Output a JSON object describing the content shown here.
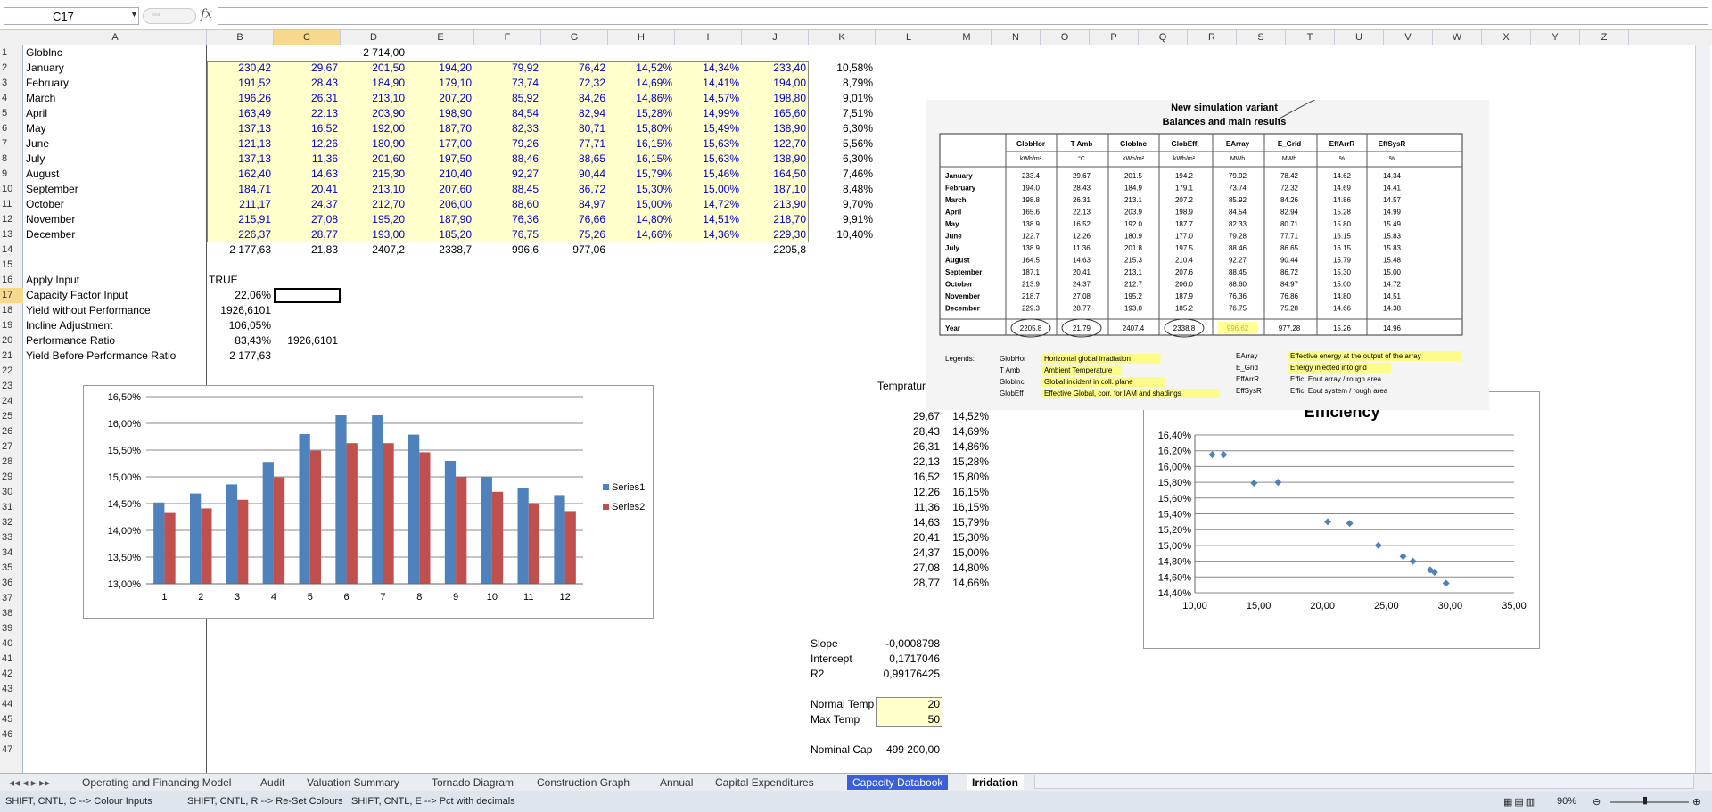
{
  "formula_bar": {
    "name_box": "C17",
    "formula": ""
  },
  "columns": [
    "A",
    "B",
    "C",
    "D",
    "E",
    "F",
    "G",
    "H",
    "I",
    "J",
    "K",
    "L",
    "M",
    "N",
    "O",
    "P",
    "Q",
    "R",
    "S",
    "T",
    "U",
    "V",
    "W",
    "X",
    "Y",
    "Z"
  ],
  "rows": {
    "1": {
      "A": "Globlnc",
      "D": "2 714,00"
    },
    "2": {
      "A": "January",
      "B": "230,42",
      "C": "29,67",
      "D": "201,50",
      "E": "194,20",
      "F": "79,92",
      "G": "76,42",
      "H": "14,52%",
      "I": "14,34%",
      "J": "233,40",
      "K": "10,58%"
    },
    "3": {
      "A": "February",
      "B": "191,52",
      "C": "28,43",
      "D": "184,90",
      "E": "179,10",
      "F": "73,74",
      "G": "72,32",
      "H": "14,69%",
      "I": "14,41%",
      "J": "194,00",
      "K": "8,79%"
    },
    "4": {
      "A": "March",
      "B": "196,26",
      "C": "26,31",
      "D": "213,10",
      "E": "207,20",
      "F": "85,92",
      "G": "84,26",
      "H": "14,86%",
      "I": "14,57%",
      "J": "198,80",
      "K": "9,01%"
    },
    "5": {
      "A": "April",
      "B": "163,49",
      "C": "22,13",
      "D": "203,90",
      "E": "198,90",
      "F": "84,54",
      "G": "82,94",
      "H": "15,28%",
      "I": "14,99%",
      "J": "165,60",
      "K": "7,51%"
    },
    "6": {
      "A": "May",
      "B": "137,13",
      "C": "16,52",
      "D": "192,00",
      "E": "187,70",
      "F": "82,33",
      "G": "80,71",
      "H": "15,80%",
      "I": "15,49%",
      "J": "138,90",
      "K": "6,30%"
    },
    "7": {
      "A": "June",
      "B": "121,13",
      "C": "12,26",
      "D": "180,90",
      "E": "177,00",
      "F": "79,26",
      "G": "77,71",
      "H": "16,15%",
      "I": "15,63%",
      "J": "122,70",
      "K": "5,56%"
    },
    "8": {
      "A": "July",
      "B": "137,13",
      "C": "11,36",
      "D": "201,60",
      "E": "197,50",
      "F": "88,46",
      "G": "88,65",
      "H": "16,15%",
      "I": "15,63%",
      "J": "138,90",
      "K": "6,30%"
    },
    "9": {
      "A": "August",
      "B": "162,40",
      "C": "14,63",
      "D": "215,30",
      "E": "210,40",
      "F": "92,27",
      "G": "90,44",
      "H": "15,79%",
      "I": "15,46%",
      "J": "164,50",
      "K": "7,46%"
    },
    "10": {
      "A": "September",
      "B": "184,71",
      "C": "20,41",
      "D": "213,10",
      "E": "207,60",
      "F": "88,45",
      "G": "86,72",
      "H": "15,30%",
      "I": "15,00%",
      "J": "187,10",
      "K": "8,48%"
    },
    "11": {
      "A": "October",
      "B": "211,17",
      "C": "24,37",
      "D": "212,70",
      "E": "206,00",
      "F": "88,60",
      "G": "84,97",
      "H": "15,00%",
      "I": "14,72%",
      "J": "213,90",
      "K": "9,70%"
    },
    "12": {
      "A": "November",
      "B": "215,91",
      "C": "27,08",
      "D": "195,20",
      "E": "187,90",
      "F": "76,36",
      "G": "76,66",
      "H": "14,80%",
      "I": "14,51%",
      "J": "218,70",
      "K": "9,91%"
    },
    "13": {
      "A": "December",
      "B": "226,37",
      "C": "28,77",
      "D": "193,00",
      "E": "185,20",
      "F": "76,75",
      "G": "75,26",
      "H": "14,66%",
      "I": "14,36%",
      "J": "229,30",
      "K": "10,40%"
    },
    "14": {
      "B": "2 177,63",
      "C": "21,83",
      "D": "2407,2",
      "E": "2338,7",
      "F": "996,6",
      "G": "977,06",
      "J": "2205,8"
    },
    "16": {
      "A": "Apply Input",
      "B": "TRUE"
    },
    "17": {
      "A": "Capacity Factor Input",
      "B": "22,06%"
    },
    "18": {
      "A": "Yield without Performance",
      "B": "1926,6101"
    },
    "19": {
      "A": "Incline Adjustment",
      "B": "106,05%"
    },
    "20": {
      "A": "Performance Ratio",
      "B": "83,43%",
      "C": "1926,6101"
    },
    "21": {
      "A": "Yield Before Performance Ratio",
      "B": "2 177,63"
    },
    "23": {
      "L": "Temprature"
    },
    "24": {
      "M": "Efficiency"
    },
    "25": {
      "L": "29,67",
      "M": "14,52%"
    },
    "26": {
      "L": "28,43",
      "M": "14,69%"
    },
    "27": {
      "L": "26,31",
      "M": "14,86%"
    },
    "28": {
      "L": "22,13",
      "M": "15,28%"
    },
    "29": {
      "L": "16,52",
      "M": "15,80%"
    },
    "30": {
      "L": "12,26",
      "M": "16,15%"
    },
    "31": {
      "L": "11,36",
      "M": "16,15%"
    },
    "32": {
      "L": "14,63",
      "M": "15,79%"
    },
    "33": {
      "L": "20,41",
      "M": "15,30%"
    },
    "34": {
      "L": "24,37",
      "M": "15,00%"
    },
    "35": {
      "L": "27,08",
      "M": "14,80%"
    },
    "36": {
      "L": "28,77",
      "M": "14,66%"
    },
    "40": {
      "K": "Slope",
      "L": "-0,0008798"
    },
    "41": {
      "K": "Intercept",
      "L": "0,1717046"
    },
    "42": {
      "K": "R2",
      "L": "0,99176425"
    },
    "44": {
      "K": "Normal Temp",
      "L": "20"
    },
    "45": {
      "K": "Max Temp",
      "L": "50"
    },
    "47": {
      "K": "Nominal Cap",
      "L": "499 200,00"
    }
  },
  "bar_chart": {
    "chart_data": {
      "type": "bar",
      "categories": [
        "1",
        "2",
        "3",
        "4",
        "5",
        "6",
        "7",
        "8",
        "9",
        "10",
        "11",
        "12"
      ],
      "series": [
        {
          "name": "Series1",
          "color": "#4f81bd",
          "values": [
            14.52,
            14.69,
            14.86,
            15.28,
            15.8,
            16.15,
            16.15,
            15.79,
            15.3,
            15.0,
            14.8,
            14.66
          ]
        },
        {
          "name": "Series2",
          "color": "#c0504d",
          "values": [
            14.34,
            14.41,
            14.57,
            14.99,
            15.49,
            15.63,
            15.63,
            15.46,
            15.0,
            14.72,
            14.51,
            14.36
          ]
        }
      ],
      "ylim": [
        13.0,
        16.5
      ],
      "yticks": [
        "13,00%",
        "13,50%",
        "14,00%",
        "14,50%",
        "15,00%",
        "15,50%",
        "16,00%",
        "16,50%"
      ],
      "legend": "right"
    }
  },
  "scatter_chart": {
    "chart_data": {
      "type": "scatter",
      "title": "Efficiency",
      "x": [
        29.67,
        28.43,
        26.31,
        22.13,
        16.52,
        12.26,
        11.36,
        14.63,
        20.41,
        24.37,
        27.08,
        28.77
      ],
      "y": [
        14.52,
        14.69,
        14.86,
        15.28,
        15.8,
        16.15,
        16.15,
        15.79,
        15.3,
        15.0,
        14.8,
        14.66
      ],
      "xlim": [
        10,
        35
      ],
      "ylim": [
        14.4,
        16.4
      ],
      "xticks": [
        "10,00",
        "15,00",
        "20,00",
        "25,00",
        "30,00",
        "35,00"
      ],
      "yticks": [
        "14,40%",
        "14,60%",
        "14,80%",
        "15,00%",
        "15,20%",
        "15,40%",
        "15,60%",
        "15,80%",
        "16,00%",
        "16,20%",
        "16,40%"
      ],
      "color": "#4f81bd"
    }
  },
  "scan": {
    "title": "New simulation variant",
    "subtitle": "Balances and main results",
    "headers": [
      "GlobHor",
      "T Amb",
      "GlobInc",
      "GlobEff",
      "EArray",
      "E_Grid",
      "EffArrR",
      "EffSysR"
    ],
    "units": [
      "kWh/m²",
      "°C",
      "kWh/m²",
      "kWh/m²",
      "MWh",
      "MWh",
      "%",
      "%"
    ],
    "rows": [
      [
        "January",
        "233.4",
        "29.67",
        "201.5",
        "194.2",
        "79.92",
        "78.42",
        "14.62",
        "14.34"
      ],
      [
        "February",
        "194.0",
        "28.43",
        "184.9",
        "179.1",
        "73.74",
        "72.32",
        "14.69",
        "14.41"
      ],
      [
        "March",
        "198.8",
        "26.31",
        "213.1",
        "207.2",
        "85.92",
        "84.26",
        "14.86",
        "14.57"
      ],
      [
        "April",
        "165.6",
        "22.13",
        "203.9",
        "198.9",
        "84.54",
        "82.94",
        "15.28",
        "14.99"
      ],
      [
        "May",
        "138.9",
        "16.52",
        "192.0",
        "187.7",
        "82.33",
        "80.71",
        "15.80",
        "15.49"
      ],
      [
        "June",
        "122.7",
        "12.26",
        "180.9",
        "177.0",
        "79.28",
        "77.71",
        "16.15",
        "15.83"
      ],
      [
        "July",
        "138.9",
        "11.36",
        "201.8",
        "197.5",
        "88.46",
        "86.65",
        "16.15",
        "15.83"
      ],
      [
        "August",
        "164.5",
        "14.63",
        "215.3",
        "210.4",
        "92.27",
        "90.44",
        "15.79",
        "15.48"
      ],
      [
        "September",
        "187.1",
        "20.41",
        "213.1",
        "207.6",
        "88.45",
        "86.72",
        "15.30",
        "15.00"
      ],
      [
        "October",
        "213.9",
        "24.37",
        "212.7",
        "206.0",
        "88.60",
        "84.97",
        "15.00",
        "14.72"
      ],
      [
        "November",
        "218.7",
        "27.08",
        "195.2",
        "187.9",
        "76.36",
        "76.86",
        "14.80",
        "14.51"
      ],
      [
        "December",
        "229.3",
        "28.77",
        "193.0",
        "185.2",
        "76.75",
        "75.28",
        "14.66",
        "14.38"
      ],
      [
        "Year",
        "2205.8",
        "21.79",
        "2407.4",
        "2338.8",
        "996.62",
        "977.28",
        "15.26",
        "14.96"
      ]
    ],
    "legend_title": "Legends:",
    "legend_left": [
      [
        "GlobHor",
        "Horizontal global irradiation"
      ],
      [
        "T Amb",
        "Ambient Temperature"
      ],
      [
        "GlobInc",
        "Global incident in coll. plane"
      ],
      [
        "GlobEff",
        "Effective Global, corr. for IAM and shadings"
      ]
    ],
    "legend_right": [
      [
        "EArray",
        "Effective energy at the output of the array"
      ],
      [
        "E_Grid",
        "Energy injected into grid"
      ],
      [
        "EffArrR",
        "Effic. Eout array / rough area"
      ],
      [
        "EffSysR",
        "Effic. Eout system / rough area"
      ]
    ]
  },
  "tabs": [
    "Operating and Financing Model",
    "Audit",
    "Valuation Summary",
    "Tornado Diagram",
    "Construction Graph",
    "Annual",
    "Capital Expenditures",
    "Capacity Databook",
    "Irridation"
  ],
  "active_tab": "Irridation",
  "status": {
    "hint1": "SHIFT, CNTL, C --> Colour Inputs",
    "hint2": "SHIFT, CNTL, R --> Re-Set Colours",
    "hint3": "SHIFT, CNTL, E --> Pct with decimals",
    "zoom": "90%"
  }
}
